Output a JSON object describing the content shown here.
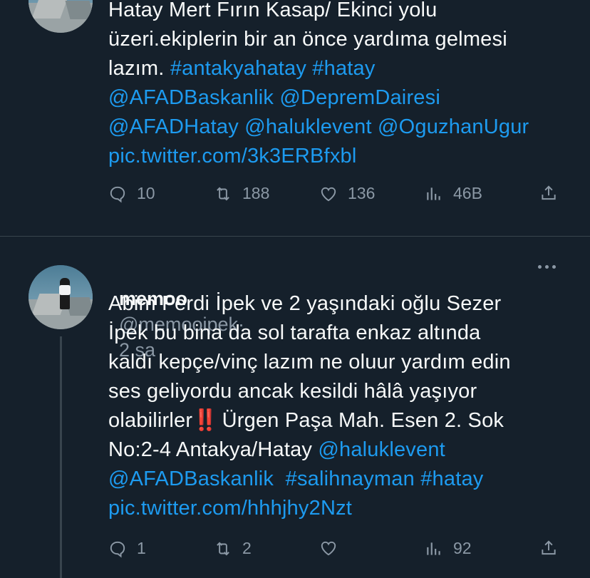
{
  "tweet1": {
    "lines": [
      [
        {
          "t": "Hatay Mert Fırın Kasap/ Ekinci yolu"
        }
      ],
      [
        {
          "t": "üzeri.ekiplerin bir an önce yardıma gelmesi"
        }
      ],
      [
        {
          "t": "lazım. "
        },
        {
          "t": "#antakyahatay #hatay",
          "link": true
        }
      ],
      [
        {
          "t": "@AFADBaskanlik @DepremDairesi",
          "link": true
        }
      ],
      [
        {
          "t": "@AFADHatay @haluklevent @OguzhanUgur",
          "link": true
        }
      ],
      [
        {
          "t": "pic.twitter.com/3k3ERBfxbl",
          "link": true
        }
      ]
    ],
    "actions": {
      "reply": "10",
      "retweet": "188",
      "like": "136",
      "views": "46B"
    }
  },
  "tweet2": {
    "name": "memoo",
    "handle": "@memooipek",
    "separator": "·",
    "time": "2 sa",
    "lines": [
      [
        {
          "t": "Abim Ferdi İpek ve 2 yaşındaki oğlu Sezer"
        }
      ],
      [
        {
          "t": "İpek bu bina da sol tarafta enkaz altında"
        }
      ],
      [
        {
          "t": "kaldı kepçe/vinç lazım ne oluur yardım edin"
        }
      ],
      [
        {
          "t": "ses geliyordu ancak kesildi hâlâ yaşıyor"
        }
      ],
      [
        {
          "t": "olabilirler"
        },
        {
          "t": "‼️",
          "emoji": true
        },
        {
          "t": " Ürgen Paşa Mah. Esen 2. Sok"
        }
      ],
      [
        {
          "t": "No:2-4 Antakya/Hatay "
        },
        {
          "t": "@haluklevent",
          "link": true
        }
      ],
      [
        {
          "t": "@AFADBaskanlik  #salihnayman #hatay",
          "link": true
        }
      ],
      [
        {
          "t": "pic.twitter.com/hhhjhy2Nzt",
          "link": true
        }
      ]
    ],
    "actions": {
      "reply": "1",
      "retweet": "2",
      "like": "",
      "views": "92"
    }
  },
  "icons": [
    "reply-icon",
    "retweet-icon",
    "like-icon",
    "views-icon",
    "share-icon",
    "more-icon"
  ],
  "colors": {
    "background": "#15202b",
    "text": "#f7f9f9",
    "link": "#1d9bf0",
    "muted": "#8b98a5",
    "divider": "#38444d"
  }
}
